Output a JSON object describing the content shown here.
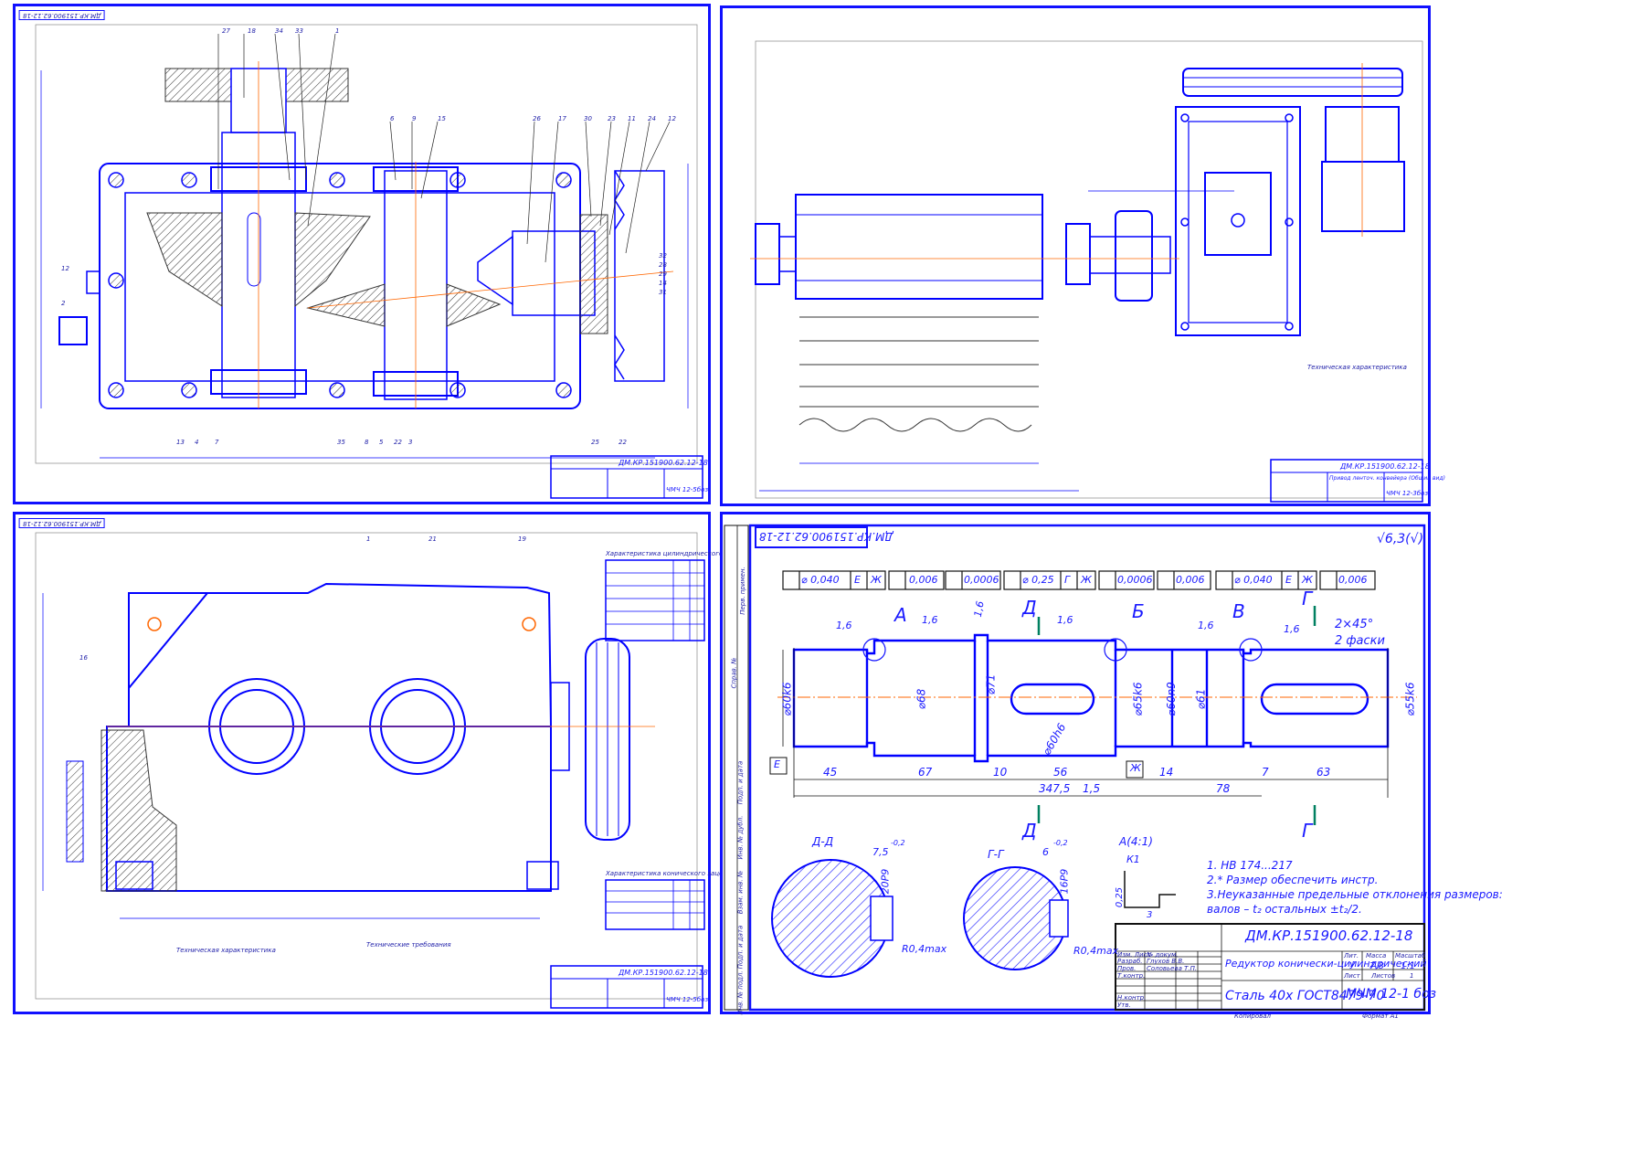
{
  "colors": {
    "line": "#0000ff",
    "frame": "#1010ff",
    "hatch": "#222222",
    "axis": "#ff6600",
    "green": "#008060"
  },
  "stamp_code": "ДМ.КР.151900.62.12-18",
  "sheet1": {
    "title_code": "ДМ.КР.151900.62.12-18",
    "subtitle": "ЧМЧ 12-5бoз",
    "callouts_top": [
      "27",
      "18",
      "34",
      "33",
      "1",
      "6",
      "9",
      "15",
      "26",
      "17",
      "30",
      "23",
      "11",
      "24",
      "12"
    ],
    "callouts_bottom": [
      "13",
      "4",
      "7",
      "35",
      "8",
      "5",
      "22",
      "3",
      "25",
      "22"
    ],
    "callouts_side": [
      "12",
      "2",
      "32",
      "28",
      "29",
      "14",
      "31"
    ]
  },
  "sheet2": {
    "title_code": "ДМ.КР.151900.62.12-18",
    "title": "Привод ленточ. конвейера (Общий вид)",
    "subtitle": "ЧМЧ 12-3бoз",
    "tech_header": "Техническая характеристика"
  },
  "sheet3": {
    "title_code": "ДМ.КР.151900.62.12-18",
    "subtitle": "ЧМЧ 12-5бoз",
    "callouts": [
      "1",
      "21",
      "19",
      "16"
    ],
    "table1_title": "Характеристика цилиндрического зацепления",
    "table2_title": "Характеристика конического зацепления",
    "notes_left_title": "Техническая характеристика",
    "notes_right_title": "Технические требования"
  },
  "sheet4": {
    "stamp_code": "ДМ.КР.151900.62.12-18",
    "roughness": "√6,3(√)",
    "tolerance_frames": [
      [
        "⌀ 0,040",
        "Е",
        "Ж"
      ],
      [
        "0,006"
      ],
      [
        "0,0006"
      ],
      [
        "⌀ 0,25",
        "Г",
        "Ж"
      ],
      [
        "0,0006"
      ],
      [
        "0,006"
      ],
      [
        "⌀ 0,040",
        "Е",
        "Ж"
      ],
      [
        "0,006"
      ]
    ],
    "section_labels": [
      "А",
      "Д",
      "Б",
      "В",
      "Г"
    ],
    "diameters": [
      "⌀60k6",
      "⌀68",
      "⌀71",
      "⌀60h6",
      "⌀65k6",
      "⌀60n9",
      "⌀61",
      "⌀55k6"
    ],
    "lengths": [
      "45",
      "67",
      "10",
      "56",
      "14",
      "78",
      "7",
      "63"
    ],
    "total_length": "347,5",
    "length_15": "1,5",
    "chamfer": "2×45°",
    "chamfer_note": "2 фаски",
    "roughness_marks": [
      "1,6",
      "1,6",
      "1,6",
      "1,6",
      "1,6",
      "1,6"
    ],
    "datum_E": "Е",
    "datum_Zh": "Ж",
    "section_DD": "Д-Д",
    "section_GG": "Г-Г",
    "dim_75": "7,5",
    "dim_6": "6",
    "dim_tol": "-0,2",
    "keyway_DD": "20P9",
    "keyway_GG": "16P9",
    "radius": "R0,4max",
    "view_A": "А(4:1)",
    "view_K1": "К1",
    "dim_025": "0,25",
    "dim_3": "3",
    "notes": [
      "1. НВ 174...217",
      "2.* Размер обеспечить инстр.",
      "3.Неуказанные предельные отклонения размеров:",
      "валов – t₂ остальных ±t₂/2."
    ],
    "title_block": {
      "code": "ДМ.КР.151900.62.12-18",
      "name": "Редуктор конически-цилиндрический",
      "material": "Сталь 40х ГОСТ8479-70",
      "group": "МЧМ 12-1 боз",
      "mass_label": "Масса",
      "scale_label": "Масштаб",
      "lit_label": "Лит.",
      "mass": "7,8",
      "scale": "1:1",
      "lit": "У",
      "sheet_label": "Лист",
      "sheets_label": "Листов",
      "sheets": "1",
      "format": "Формат А1",
      "copied": "Копировал",
      "rows": [
        "Изм. Лист",
        "Разраб.",
        "Пров.",
        "Т.контр.",
        "",
        "Н.контр.",
        "Утв."
      ],
      "row_names": [
        "№ докум.",
        "Глухов В.В.",
        "Соловьева Т.П."
      ]
    },
    "side_labels": [
      "Перв. примен.",
      "Справ. №",
      "Подп. и дата",
      "Инв. № дубл.",
      "Взам. инв. №",
      "Подп. и дата",
      "Инв. № подл."
    ]
  }
}
